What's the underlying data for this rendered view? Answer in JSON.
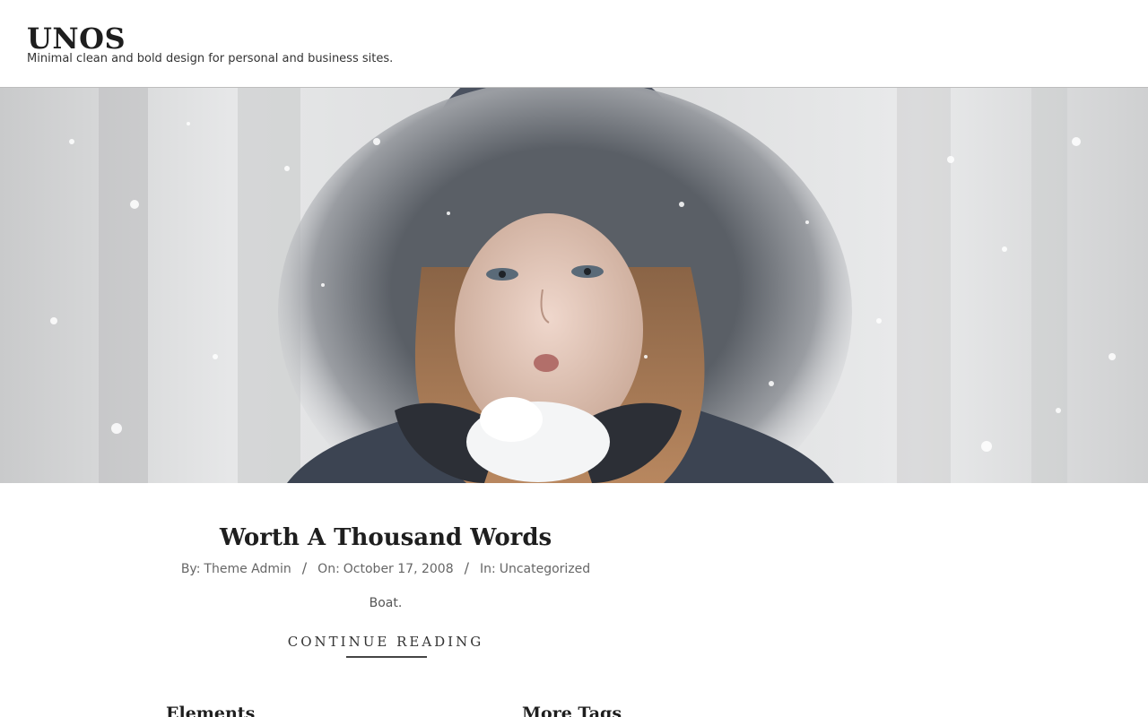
{
  "site": {
    "title": "UNOS",
    "tagline": "Minimal clean and bold design for personal and business sites."
  },
  "hero": {
    "image_alt": "Woman in fur-trimmed hood blowing snow from gloved hands"
  },
  "post": {
    "title": "Worth A Thousand Words",
    "meta": {
      "by_label": "By:",
      "author": "Theme Admin",
      "separator": "/",
      "on_label": "On:",
      "date": "October 17, 2008",
      "in_label": "In:",
      "category": "Uncategorized"
    },
    "excerpt": "Boat.",
    "continue_label": "CONTINUE READING"
  },
  "widgets": {
    "left_title": "Elements",
    "right_title": "More Tags"
  },
  "colors": {
    "text": "#1e1e1e",
    "meta": "#666666",
    "header_border": "#bdbdbd"
  }
}
